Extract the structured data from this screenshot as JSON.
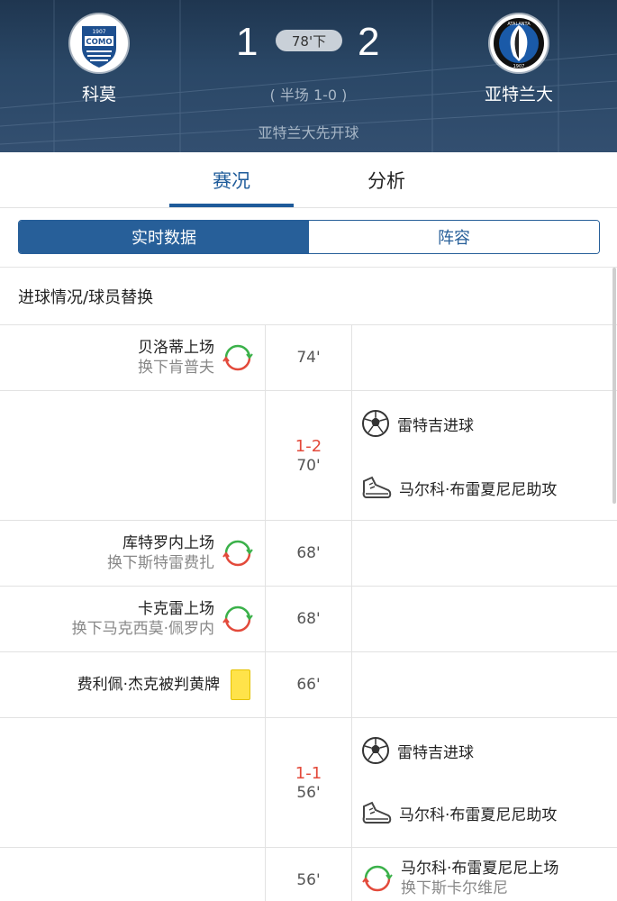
{
  "match": {
    "home_name": "科莫",
    "away_name": "亚特兰大",
    "home_score": "1",
    "away_score": "2",
    "minute": "78'下",
    "halftime": "( 半场 1-0 )",
    "kickoff": "亚特兰大先开球",
    "home_logo_text": "COMO",
    "home_logo_year": "1907",
    "away_logo_text": "ATALANTA",
    "away_logo_year": "1907"
  },
  "tabs": {
    "live": "赛况",
    "analysis": "分析"
  },
  "segment": {
    "live_data": "实时数据",
    "lineup": "阵容"
  },
  "section_title": "进球情况/球员替换",
  "events": [
    {
      "side": "home",
      "type": "sub",
      "minute": "74'",
      "line1": "贝洛蒂上场",
      "line2": "换下肯普夫"
    },
    {
      "side": "away",
      "type": "goal",
      "minute": "70'",
      "score": "1-2",
      "goal": "雷特吉进球",
      "assist": "马尔科·布雷夏尼尼助攻"
    },
    {
      "side": "home",
      "type": "sub",
      "minute": "68'",
      "line1": "库特罗内上场",
      "line2": "换下斯特雷费扎"
    },
    {
      "side": "home",
      "type": "sub",
      "minute": "68'",
      "line1": "卡克雷上场",
      "line2": "换下马克西莫·佩罗内"
    },
    {
      "side": "home",
      "type": "yellow",
      "minute": "66'",
      "line1": "费利佩·杰克被判黄牌"
    },
    {
      "side": "away",
      "type": "goal",
      "minute": "56'",
      "score": "1-1",
      "goal": "雷特吉进球",
      "assist": "马尔科·布雷夏尼尼助攻"
    },
    {
      "side": "away",
      "type": "sub",
      "minute": "56'",
      "line1": "马尔科·布雷夏尼尼上场",
      "line2": "换下斯卡尔维尼"
    }
  ],
  "colors": {
    "accent": "#275f99",
    "score_red": "#e34a3b",
    "header": "#2a4766",
    "yellow_card": "#ffe34a"
  }
}
